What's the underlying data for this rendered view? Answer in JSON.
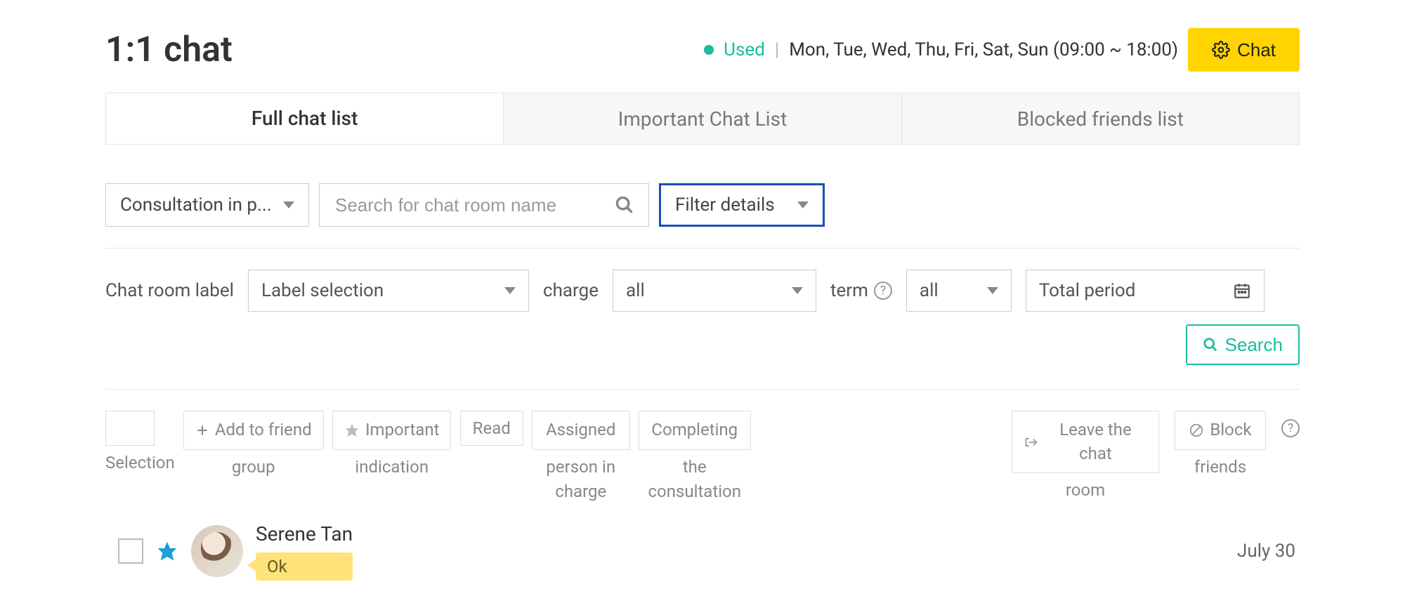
{
  "header": {
    "title": "1:1 chat",
    "status": "Used",
    "schedule": "Mon, Tue, Wed, Thu, Fri, Sat, Sun  (09:00 ~ 18:00)",
    "chat_button": "Chat"
  },
  "tabs": [
    {
      "label": "Full chat list",
      "active": true
    },
    {
      "label": "Important Chat List",
      "active": false
    },
    {
      "label": "Blocked friends list",
      "active": false
    }
  ],
  "filters1": {
    "consultation_select": "Consultation in p...",
    "search_placeholder": "Search for chat room name",
    "filter_details": "Filter details"
  },
  "filters2": {
    "chat_room_label_text": "Chat room label",
    "label_selection": "Label selection",
    "charge_text": "charge",
    "charge_value": "all",
    "term_text": "term",
    "term_value": "all",
    "period_value": "Total period",
    "search_button": "Search"
  },
  "actions": {
    "selection": "Selection",
    "add_friend_top": "Add to friend",
    "add_friend_bottom": "group",
    "important_top": "Important",
    "important_bottom": "indication",
    "read": "Read",
    "assigned_l1": "Assigned",
    "assigned_l2": "person in",
    "assigned_l3": "charge",
    "complete_l1": "Completing",
    "complete_l2": "the",
    "complete_l3": "consultation",
    "leave_top": "Leave the chat",
    "leave_bottom": "room",
    "block_top": "Block",
    "block_bottom": "friends"
  },
  "chat_list": [
    {
      "name": "Serene Tan",
      "last_message": "Ok",
      "date": "July 30",
      "starred": true
    }
  ]
}
